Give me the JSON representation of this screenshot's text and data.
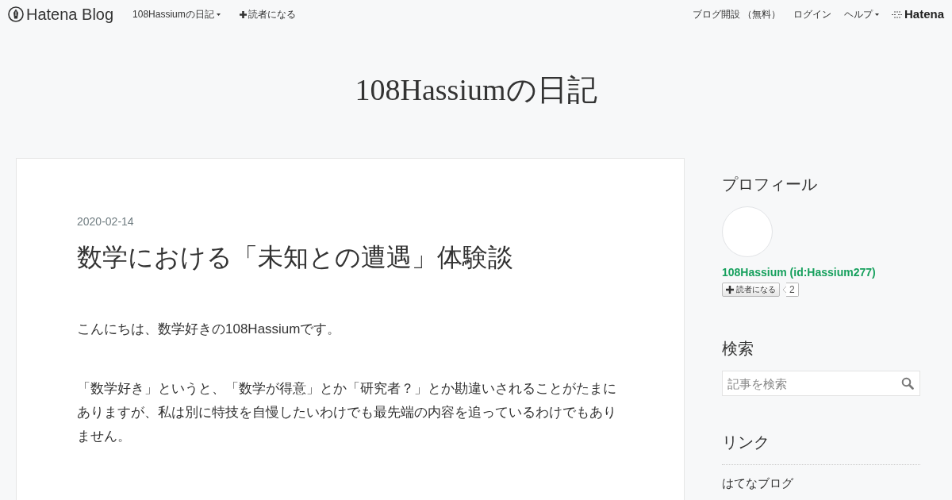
{
  "top_bar": {
    "logo": "Hatena Blog",
    "left_items": [
      {
        "kind": "dropdown",
        "label": "108Hassiumの日記"
      },
      {
        "kind": "subscribe",
        "label": "読者になる"
      }
    ],
    "right_items": [
      {
        "kind": "link",
        "label": "ブログ開設 （無料）"
      },
      {
        "kind": "link",
        "label": "ログイン"
      },
      {
        "kind": "dropdown",
        "label": "ヘルプ"
      }
    ],
    "brand": "Hatena"
  },
  "blog_title": "108Hassiumの日記",
  "article": {
    "date": "2020-02-14",
    "title": "数学における「未知との遭遇」体験談",
    "paragraphs": [
      "こんにちは、数学好きの108Hassiumです。",
      "「数学好き」というと、「数学が得意」とか「研究者？」とか勘違いされることがたまにありますが、私は別に特技を自慢したいわけでも最先端の内容を追っているわけでもありません。"
    ]
  },
  "sidebar": {
    "profile": {
      "heading": "プロフィール",
      "name": "108Hassium (id:Hassium277)",
      "subscribe_button": "読者になる",
      "subscriber_count": "2"
    },
    "search": {
      "heading": "検索",
      "placeholder": "記事を検索"
    },
    "links": {
      "heading": "リンク",
      "items": [
        "はてなブログ"
      ]
    }
  }
}
